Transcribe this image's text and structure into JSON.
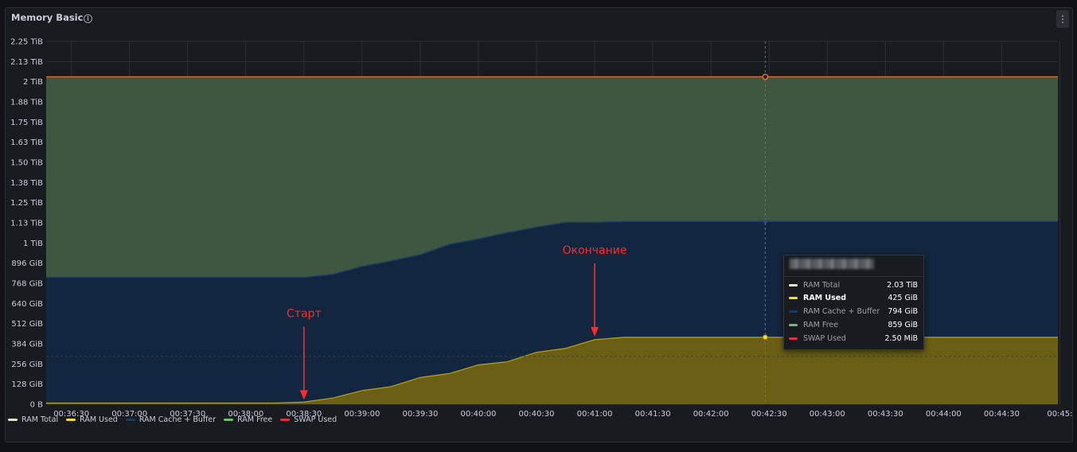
{
  "panel": {
    "title": "Memory Basic",
    "info_icon": "info-icon",
    "menu_icon": "kebab-menu-icon",
    "menu_glyph": "⋮"
  },
  "chart_data": {
    "type": "area",
    "title": "Memory Basic",
    "y_ticks": [
      "0 B",
      "128 GiB",
      "256 GiB",
      "384 GiB",
      "512 GiB",
      "640 GiB",
      "768 GiB",
      "896 GiB",
      "1 TiB",
      "1.13 TiB",
      "1.25 TiB",
      "1.38 TiB",
      "1.50 TiB",
      "1.63 TiB",
      "1.75 TiB",
      "1.88 TiB",
      "2 TiB",
      "2.13 TiB",
      "2.25 TiB"
    ],
    "y_unit": "GiB",
    "ylim": [
      0,
      2304
    ],
    "x_ticks": [
      "00:36:30",
      "00:37:00",
      "00:37:30",
      "00:38:00",
      "00:38:30",
      "00:39:00",
      "00:39:30",
      "00:40:00",
      "00:40:30",
      "00:41:00",
      "00:41:30",
      "00:42:00",
      "00:42:30",
      "00:43:00",
      "00:43:30",
      "00:44:00",
      "00:44:30",
      "00:45:"
    ],
    "x_tick_seconds": [
      30,
      60,
      90,
      120,
      150,
      180,
      210,
      240,
      270,
      300,
      330,
      360,
      390,
      420,
      450,
      480,
      510,
      540
    ],
    "xlim_seconds": [
      17,
      539
    ],
    "x_origin_label": "00:36:00",
    "x_unit": "seconds after x_origin_label",
    "x": [
      17,
      30,
      45,
      60,
      75,
      90,
      105,
      120,
      135,
      150,
      165,
      180,
      195,
      210,
      225,
      240,
      255,
      270,
      285,
      300,
      315,
      330,
      345,
      360,
      375,
      390,
      405,
      420,
      435,
      450,
      465,
      480,
      495,
      510,
      525,
      539
    ],
    "series": [
      {
        "name": "RAM Total",
        "color": "#e6e9c7",
        "values": [
          2079,
          2079,
          2079,
          2079,
          2079,
          2079,
          2079,
          2079,
          2079,
          2079,
          2079,
          2079,
          2079,
          2079,
          2079,
          2079,
          2079,
          2079,
          2079,
          2079,
          2079,
          2079,
          2079,
          2079,
          2079,
          2079,
          2079,
          2079,
          2079,
          2079,
          2079,
          2079,
          2079,
          2079,
          2079,
          2079
        ]
      },
      {
        "name": "RAM Used",
        "color": "#fade2a",
        "values": [
          8,
          8,
          8,
          8,
          8,
          8,
          8,
          8,
          8,
          14,
          40,
          87,
          112,
          170,
          195,
          250,
          270,
          330,
          355,
          410,
          425,
          425,
          425,
          425,
          425,
          425,
          425,
          425,
          425,
          425,
          425,
          425,
          425,
          425,
          425,
          425
        ]
      },
      {
        "name": "RAM Cache + Buffer",
        "color": "#1f3a5f",
        "values": [
          797,
          797,
          797,
          797,
          797,
          797,
          797,
          797,
          797,
          791,
          785,
          788,
          798,
          780,
          820,
          800,
          820,
          795,
          800,
          745,
          735,
          735,
          735,
          735,
          735,
          735,
          735,
          735,
          735,
          735,
          735,
          735,
          735,
          735,
          735,
          735
        ]
      },
      {
        "name": "RAM Free",
        "color": "#73bf69",
        "values": [
          1274,
          1274,
          1274,
          1274,
          1274,
          1274,
          1274,
          1274,
          1274,
          1274,
          1254,
          1204,
          1169,
          1129,
          1064,
          1029,
          989,
          954,
          924,
          924,
          919,
          919,
          919,
          919,
          919,
          919,
          919,
          919,
          919,
          919,
          919,
          919,
          919,
          919,
          919,
          919
        ]
      },
      {
        "name": "SWAP Used",
        "color": "#e02f44",
        "values": [
          0,
          0,
          0,
          0,
          0,
          0,
          0,
          0,
          0,
          0,
          0,
          0,
          0,
          0,
          0,
          0,
          0,
          0,
          0,
          0,
          0,
          0,
          0,
          0,
          0,
          0,
          0,
          0,
          0,
          0,
          0,
          0,
          0,
          0,
          0,
          0
        ]
      }
    ],
    "hover_x_seconds": 388,
    "tooltip": {
      "rows": [
        {
          "name": "RAM Total",
          "value": "2.03 TiB"
        },
        {
          "name": "RAM Used",
          "value": "425 GiB"
        },
        {
          "name": "RAM Cache + Buffer",
          "value": "794 GiB"
        },
        {
          "name": "RAM Free",
          "value": "859 GiB"
        },
        {
          "name": "SWAP Used",
          "value": "2.50 MiB"
        }
      ]
    },
    "annotations": [
      {
        "text": "Старт",
        "x_seconds": 150,
        "y_value": 8
      },
      {
        "text": "Окончание",
        "x_seconds": 300,
        "y_value": 410
      }
    ],
    "grid": true,
    "legend_position": "bottom-left",
    "background_color": "#181b1f",
    "text_color": "#ccccdc",
    "grid_color": "#2c2f35",
    "annotation_color": "#ff2b2b"
  }
}
